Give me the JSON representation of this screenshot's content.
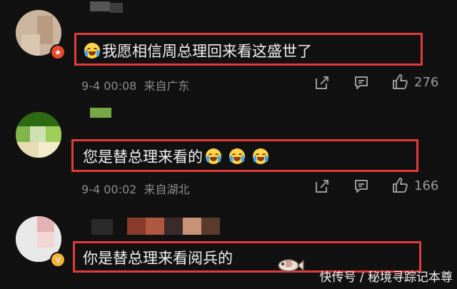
{
  "comments": [
    {
      "text": "我愿相信周总理回来看这盛世了",
      "emoji_before": "crying-face-icon",
      "time": "9-4 00:08",
      "location": "来自广东",
      "likes": "276",
      "badge": "red-star-badge-icon"
    },
    {
      "text": "您是替总理来看的",
      "emoji_after_count": 3,
      "emoji_after": "crying-face-icon",
      "time": "9-4 00:02",
      "location": "来自湖北",
      "likes": "166"
    },
    {
      "text": "你是替总理来看阅兵的",
      "badge": "gold-verified-badge-icon"
    }
  ],
  "watermark": "快传号 / 秘境寻踪记本尊",
  "colors": {
    "background": "#111111",
    "highlight": "#e23b3b",
    "meta_text": "#8c8c8c",
    "comment_text": "#f1f1f1"
  }
}
